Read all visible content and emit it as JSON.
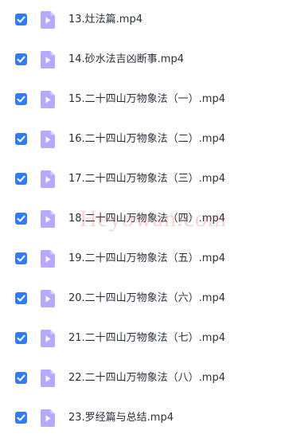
{
  "colors": {
    "checkbox": "#2f7dff",
    "file_icon": "#b9a8ff",
    "file_icon_play": "#ffffff",
    "text": "#2a2f3a"
  },
  "files": [
    {
      "name": "13.灶法篇.mp4",
      "checked": true,
      "icon": "video-file-icon"
    },
    {
      "name": "14.砂水法吉凶断事.mp4",
      "checked": true,
      "icon": "video-file-icon"
    },
    {
      "name": "15.二十四山万物象法（一）.mp4",
      "checked": true,
      "icon": "video-file-icon"
    },
    {
      "name": "16.二十四山万物象法（二）.mp4",
      "checked": true,
      "icon": "video-file-icon"
    },
    {
      "name": "17.二十四山万物象法（三）.mp4",
      "checked": true,
      "icon": "video-file-icon"
    },
    {
      "name": "18.二十四山万物象法（四）.mp4",
      "checked": true,
      "icon": "video-file-icon"
    },
    {
      "name": "19.二十四山万物象法（五）.mp4",
      "checked": true,
      "icon": "video-file-icon"
    },
    {
      "name": "20.二十四山万物象法（六）.mp4",
      "checked": true,
      "icon": "video-file-icon"
    },
    {
      "name": "21.二十四山万物象法（七）.mp4",
      "checked": true,
      "icon": "video-file-icon"
    },
    {
      "name": "22.二十四山万物象法（八）.mp4",
      "checked": true,
      "icon": "video-file-icon"
    },
    {
      "name": "23.罗经篇与总结.mp4",
      "checked": true,
      "icon": "video-file-icon"
    }
  ],
  "watermark": "Heyowan.com"
}
